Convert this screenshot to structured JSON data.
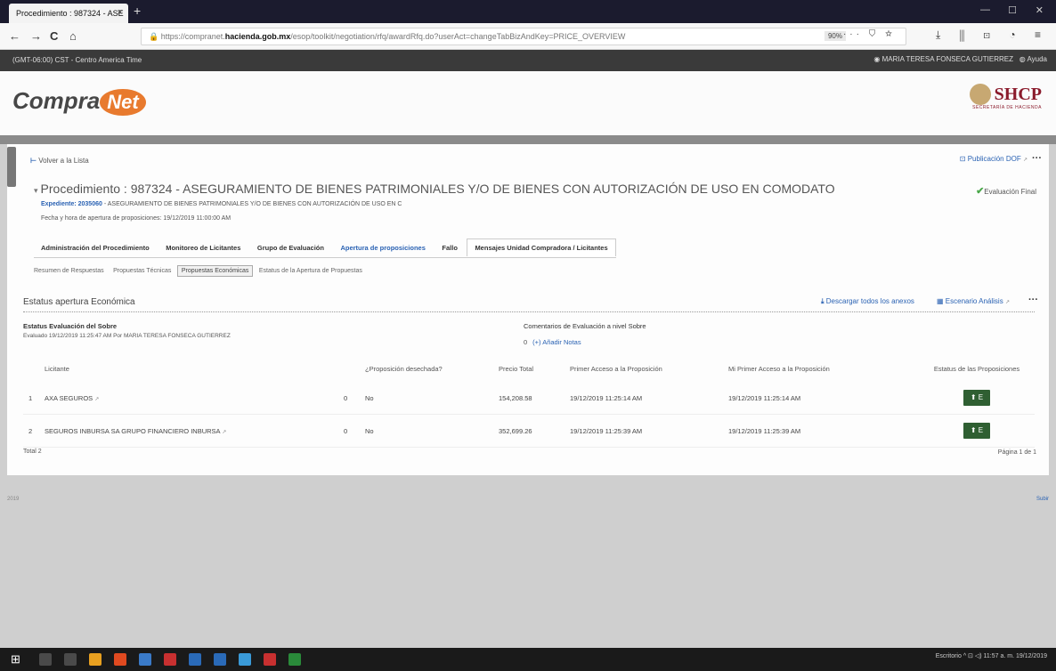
{
  "browser": {
    "tab_title": "Procedimiento : 987324 - ASE",
    "tab_close": "×",
    "new_tab": "+",
    "url_prefix": "https://compranet.",
    "url_host": "hacienda.gob.mx",
    "url_path": "/esop/toolkit/negotiation/rfq/awardRfq.do?userAct=changeTabBizAndKey=PRICE_OVERVIEW",
    "zoom": "90%",
    "url_icons": "··· ⛉ ☆",
    "toolbar_icons": "⤓ ⫼ ⊡ ◔ ≡",
    "back": "←",
    "forward": "→",
    "reload": "C",
    "home": "⌂",
    "minimize": "—",
    "maximize": "☐",
    "close": "✕"
  },
  "appbar": {
    "timezone": "(GMT-06:00) CST - Centro America Time",
    "user": "MARIA TERESA FONSECA GUTIERREZ",
    "help": "Ayuda"
  },
  "header": {
    "logo_compra": "Compra",
    "logo_net": "Net",
    "shcp": "SHCP",
    "shcp_sub": "SECRETARÍA DE HACIENDA"
  },
  "panel": {
    "back": "Volver a la Lista",
    "publicacion": "Publicación DOF",
    "more": "···",
    "title": "Procedimiento : 987324 - ASEGURAMIENTO DE BIENES PATRIMONIALES Y/O DE BIENES CON AUTORIZACIÓN DE USO EN COMODATO",
    "eval_status": "Evaluación Final",
    "expediente_label": "Expediente: ",
    "expediente_num": "2035060",
    "expediente_desc": " - ASEGURAMIENTO DE BIENES PATRIMONIALES Y/O DE BIENES CON AUTORIZACIÓN DE USO EN C",
    "fecha": "Fecha y hora de apertura de proposiciones: 19/12/2019 11:00:00 AM"
  },
  "tabs": [
    "Administración del Procedimiento",
    "Monitoreo de Licitantes",
    "Grupo de Evaluación",
    "Apertura de proposiciones",
    "Fallo",
    "Mensajes Unidad Compradora / Licitantes"
  ],
  "subtabs": [
    "Resumen de Respuestas",
    "Propuestas Técnicas",
    "Propuestas Económicas",
    "Estatus de la Apertura de Propuestas"
  ],
  "section": {
    "title": "Estatus apertura Económica",
    "download": "Descargar todos los anexos",
    "escenario": "Escenario Análisis",
    "more": "···",
    "estatus_label": "Estatus Evaluación del Sobre",
    "estatus_line": "Evaluado 19/12/2019 11:25:47 AM  Por MARIA TERESA FONSECA GUTIERREZ",
    "comentarios_label": "Comentarios de Evaluación a nivel Sobre",
    "comentarios_count": "0",
    "comentarios_add": "(+) Añadir Notas"
  },
  "table": {
    "headers": [
      "",
      "Licitante",
      "",
      "¿Proposición desechada?",
      "Precio Total",
      "Primer Acceso a la Proposición",
      "Mi Primer Acceso a la Proposición",
      "Estatus de las Proposiciones"
    ],
    "rows": [
      {
        "num": "1",
        "licitante": "AXA SEGUROS",
        "zero": "0",
        "desechada": "No",
        "precio": "154,208.58",
        "primer": "19/12/2019 11:25:14 AM",
        "mi_primer": "19/12/2019 11:25:14 AM",
        "estatus": "⬆ E"
      },
      {
        "num": "2",
        "licitante": "SEGUROS INBURSA SA GRUPO FINANCIERO INBURSA",
        "zero": "0",
        "desechada": "No",
        "precio": "352,699.26",
        "primer": "19/12/2019 11:25:39 AM",
        "mi_primer": "19/12/2019 11:25:39 AM",
        "estatus": "⬆ E"
      }
    ],
    "total": "Total 2",
    "pagina": "Página 1 de 1"
  },
  "footer": {
    "left": "2019",
    "right": "Subir"
  },
  "taskbar": {
    "start": "⊞",
    "tray": "Escritorio  ^  ⊡ ◁)  11:57 a. m.  19/12/2019",
    "icon_colors": [
      "#4a4a4a",
      "#4a4a4a",
      "#e8a020",
      "#e04a20",
      "#3a7ac8",
      "#c83030",
      "#2a6ab8",
      "#2a6ab8",
      "#3a9ad8",
      "#c83030",
      "#2a8a3a"
    ]
  }
}
